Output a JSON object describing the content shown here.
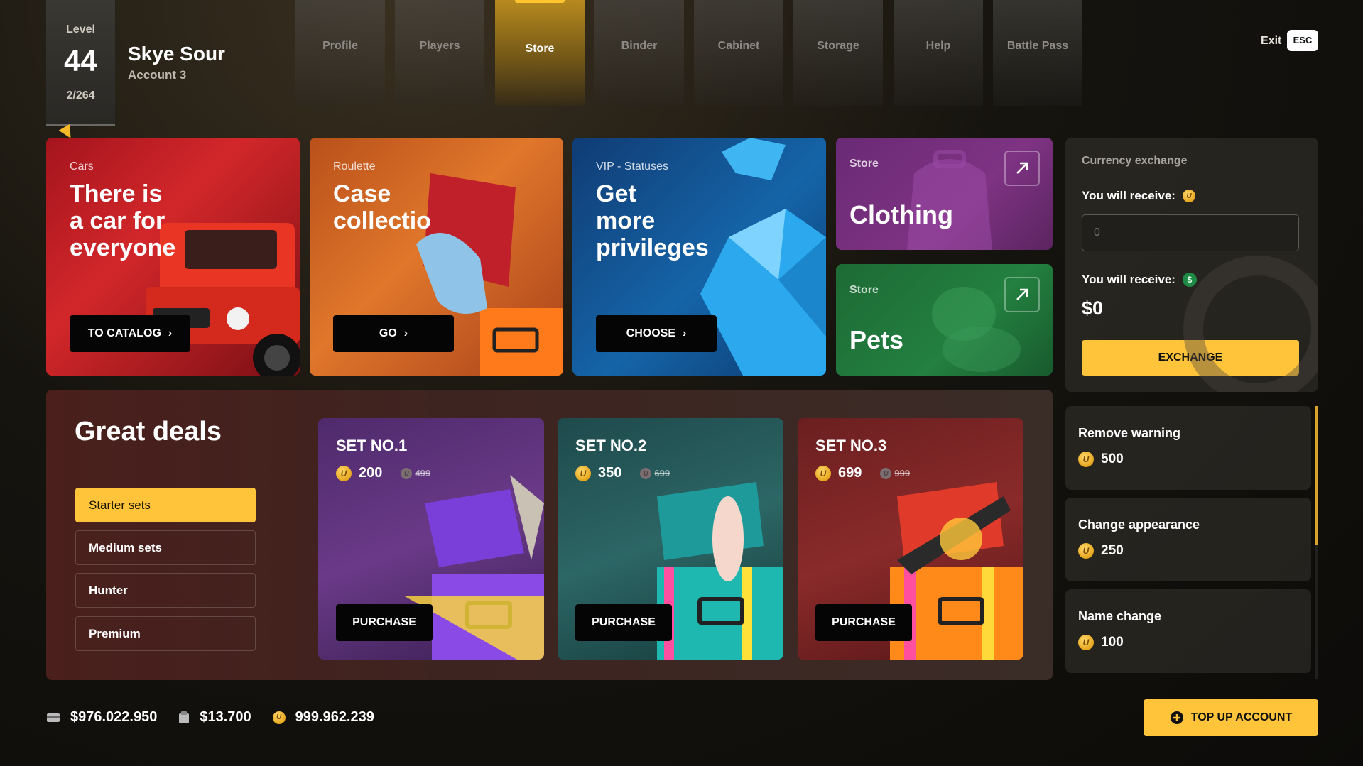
{
  "header": {
    "level_label": "Level",
    "level_value": "44",
    "level_progress": "2/264",
    "player_name": "Skye Sour",
    "account": "Account 3",
    "exit_label": "Exit",
    "exit_key": "ESC"
  },
  "nav": {
    "tabs": [
      {
        "label": "Profile"
      },
      {
        "label": "Players"
      },
      {
        "label": "Store",
        "active": true
      },
      {
        "label": "Binder"
      },
      {
        "label": "Cabinet"
      },
      {
        "label": "Storage"
      },
      {
        "label": "Help"
      },
      {
        "label": "Battle Pass"
      }
    ]
  },
  "promos": {
    "cars": {
      "category": "Cars",
      "title": "There is\na car for\neveryone",
      "button": "TO CATALOG"
    },
    "roulette": {
      "category": "Roulette",
      "title": "Case\ncollectio",
      "button": "GO"
    },
    "vip": {
      "category": "VIP - Statuses",
      "title": "Get\nmore\nprivileges",
      "button": "CHOOSE"
    }
  },
  "store_cards": {
    "clothing": {
      "label": "Store",
      "title": "Clothing"
    },
    "pets": {
      "label": "Store",
      "title": "Pets"
    }
  },
  "exchange": {
    "title": "Currency exchange",
    "receive_label_1": "You will receive:",
    "input_placeholder": "0",
    "receive_label_2": "You will receive:",
    "amount": "$0",
    "button": "EXCHANGE"
  },
  "services": [
    {
      "title": "Remove warning",
      "price": "500"
    },
    {
      "title": "Change appearance",
      "price": "250"
    },
    {
      "title": "Name change",
      "price": "100"
    }
  ],
  "deals": {
    "title": "Great deals",
    "filters": [
      {
        "label": "Starter sets",
        "active": true
      },
      {
        "label": "Medium sets"
      },
      {
        "label": "Hunter"
      },
      {
        "label": "Premium"
      }
    ],
    "sets": [
      {
        "title": "SET NO.1",
        "price": "200",
        "old_price": "499",
        "button": "PURCHASE"
      },
      {
        "title": "SET NO.2",
        "price": "350",
        "old_price": "699",
        "button": "PURCHASE"
      },
      {
        "title": "SET NO.3",
        "price": "699",
        "old_price": "999",
        "button": "PURCHASE"
      }
    ]
  },
  "footer": {
    "cash": "$976.022.950",
    "bank": "$13.700",
    "coins": "999.962.239",
    "topup_button": "TOP UP ACCOUNT"
  },
  "colors": {
    "accent": "#ffc43a",
    "cars_card": "#c41e24",
    "roulette_card": "#d96a26",
    "vip_card": "#1461a6",
    "clothing_card": "#7a3180",
    "pets_card": "#227a3d"
  }
}
